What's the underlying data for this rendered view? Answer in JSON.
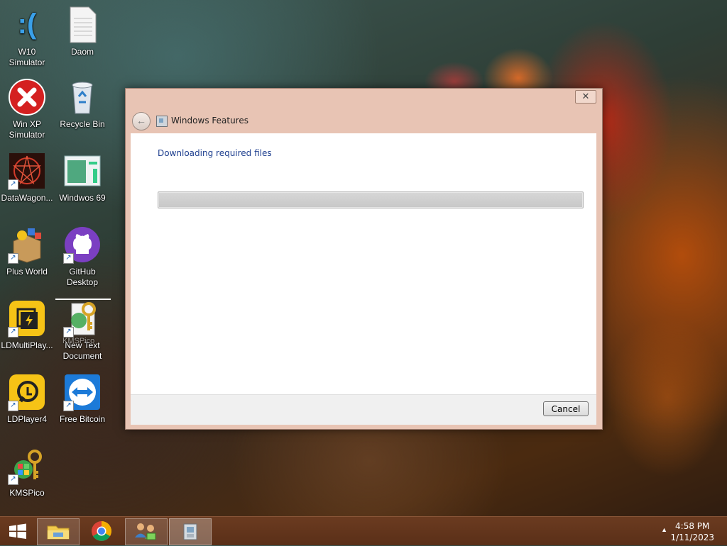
{
  "desktop": {
    "icons": [
      {
        "label": "W10\nSimulator"
      },
      {
        "label": "Daom"
      },
      {
        "label": "Win XP\nSimulator"
      },
      {
        "label": "Recycle Bin"
      },
      {
        "label": "DataWagon..."
      },
      {
        "label": "Windwos 69"
      },
      {
        "label": "Plus World"
      },
      {
        "label": "GitHub\nDesktop"
      },
      {
        "label": "LDMultiPlay..."
      },
      {
        "label": "New Text\nDocument"
      },
      {
        "label": "LDPlayer4"
      },
      {
        "label": "Free Bitcoin"
      },
      {
        "label": "KMSPico"
      }
    ],
    "ghost_label": "KMSPico"
  },
  "dialog": {
    "title": "Windows Features",
    "status": "Downloading required files",
    "progress": 1.0,
    "close_symbol": "✕",
    "back_symbol": "←",
    "cancel_label": "Cancel"
  },
  "taskbar": {
    "time": "4:58 PM",
    "date": "1/11/2023",
    "tray_arrow": "▲"
  }
}
